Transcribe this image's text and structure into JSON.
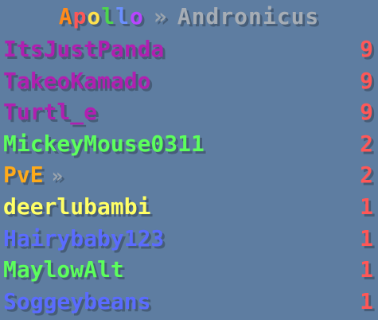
{
  "header": {
    "team_left": "Apollo",
    "separator": "»",
    "team_right": "Andronicus",
    "colors": {
      "apollo_letters": [
        "#ff8a1a",
        "#ff5757",
        "#ffe14d",
        "#4dd64d",
        "#6b8fff",
        "#b844ff"
      ],
      "team_right": "#a6adb5",
      "separator": "#9aa4ae"
    }
  },
  "players": [
    {
      "name": "ItsJustPanda",
      "score": "9",
      "color": "#b020b0",
      "suffix": ""
    },
    {
      "name": "TakeoKamado",
      "score": "9",
      "color": "#b020b0",
      "suffix": ""
    },
    {
      "name": "Turtl_e",
      "score": "9",
      "color": "#b020b0",
      "suffix": ""
    },
    {
      "name": "MickeyMouse0311",
      "score": "2",
      "color": "#5cff5c",
      "suffix": ""
    },
    {
      "name": "PvE",
      "score": "2",
      "color": "#ffaa1a",
      "suffix": "»"
    },
    {
      "name": "deerlubambi",
      "score": "1",
      "color": "#ffff66",
      "suffix": ""
    },
    {
      "name": "Hairybaby123",
      "score": "1",
      "color": "#5a6bff",
      "suffix": ""
    },
    {
      "name": "MaylowAlt",
      "score": "1",
      "color": "#5cff5c",
      "suffix": ""
    },
    {
      "name": "Soggeybeans",
      "score": "1",
      "color": "#5a6bff",
      "suffix": ""
    }
  ],
  "score_color": "#ff5757"
}
